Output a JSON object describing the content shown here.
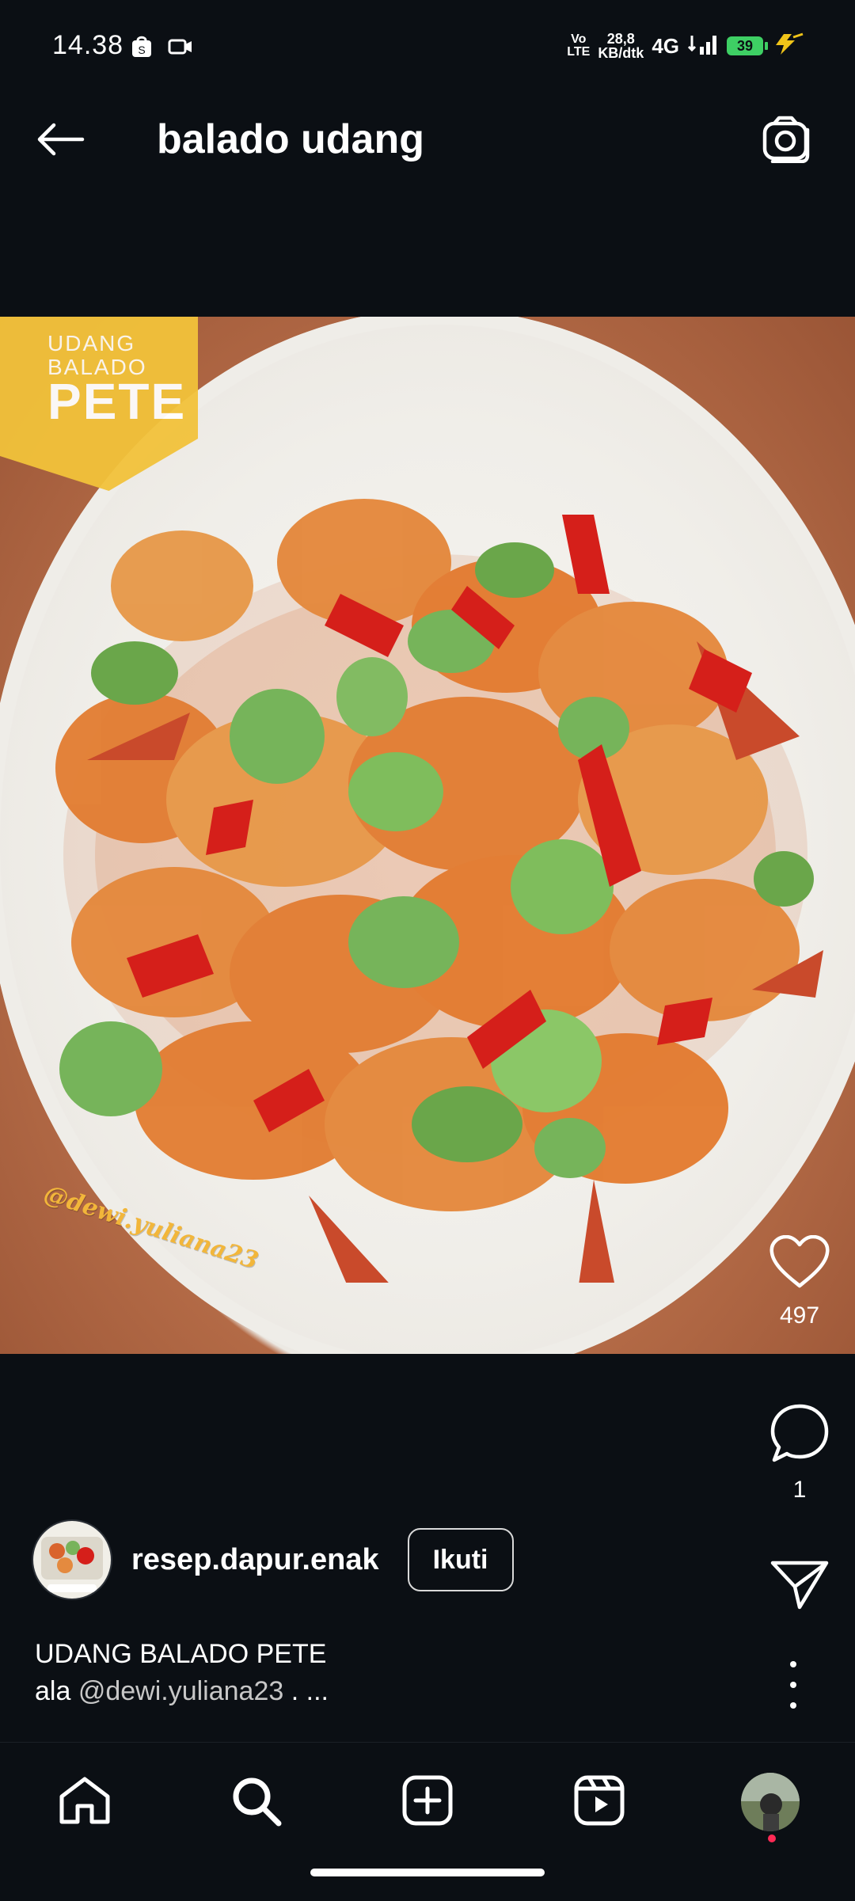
{
  "status_bar": {
    "time": "14.38",
    "volte_top": "Vo",
    "volte_bottom": "LTE",
    "net_speed_top": "28,8",
    "net_speed_bottom": "KB/dtk",
    "network_type": "4G",
    "battery": "39"
  },
  "header": {
    "title": "balado udang"
  },
  "media": {
    "badge_line1": "UDANG",
    "badge_line2": "BALADO",
    "badge_line3": "PETE",
    "watermark": "@dewi.yuliana23"
  },
  "actions": {
    "likes": "497",
    "comments": "1"
  },
  "author": {
    "username": "resep.dapur.enak",
    "follow_label": "Ikuti"
  },
  "caption": {
    "title": "UDANG BALADO PETE",
    "prefix": "ala ",
    "mention": "@dewi.yuliana23",
    "suffix": " . ..."
  },
  "colors": {
    "background": "#0b0f14",
    "text": "#ffffff",
    "battery": "#3ecf64",
    "badge": "#f2c23a"
  }
}
